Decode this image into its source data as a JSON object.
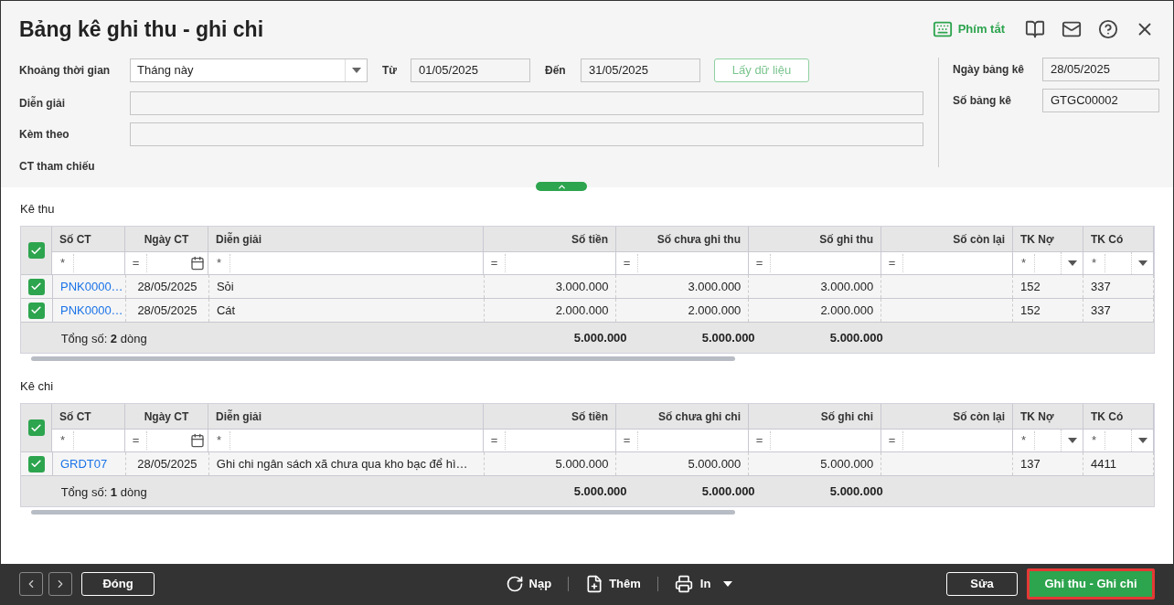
{
  "window": {
    "title": "Bảng kê ghi thu - ghi chi"
  },
  "header_actions": {
    "shortcuts": "Phím tắt"
  },
  "form": {
    "period_label": "Khoảng thời gian",
    "period_value": "Tháng này",
    "from_label": "Từ",
    "from_value": "01/05/2025",
    "to_label": "Đến",
    "to_value": "31/05/2025",
    "fetch_button": "Lấy dữ liệu",
    "description_label": "Diễn giải",
    "attached_label": "Kèm theo",
    "reference_label": "CT tham chiếu",
    "date_label": "Ngày bảng kê",
    "date_value": "28/05/2025",
    "number_label": "Số bảng kê",
    "number_value": "GTGC00002"
  },
  "sections": [
    {
      "title": "Kê thu",
      "all_checked": true,
      "columns": [
        {
          "label": "Số CT",
          "filter": "*",
          "kind": "text"
        },
        {
          "label": "Ngày CT",
          "filter": "=",
          "kind": "date"
        },
        {
          "label": "Diễn giải",
          "filter": "*",
          "kind": "text"
        },
        {
          "label": "Số tiền",
          "filter": "=",
          "kind": "number",
          "total": "5.000.000"
        },
        {
          "label": "Số chưa ghi thu",
          "filter": "=",
          "kind": "number",
          "total": "5.000.000"
        },
        {
          "label": "Số ghi thu",
          "filter": "=",
          "kind": "number",
          "total": "5.000.000"
        },
        {
          "label": "Số còn lại",
          "filter": "=",
          "kind": "number"
        },
        {
          "label": "TK Nợ",
          "filter": "*",
          "kind": "account"
        },
        {
          "label": "TK Có",
          "filter": "*",
          "kind": "account"
        }
      ],
      "rows": [
        {
          "checked": true,
          "voucher": "PNK0000…",
          "date": "28/05/2025",
          "description": "Sỏi",
          "amount": "3.000.000",
          "pending": "3.000.000",
          "recorded": "3.000.000",
          "debit": "152",
          "credit": "337"
        },
        {
          "checked": true,
          "voucher": "PNK0000…",
          "date": "28/05/2025",
          "description": "Cát",
          "amount": "2.000.000",
          "pending": "2.000.000",
          "recorded": "2.000.000",
          "debit": "152",
          "credit": "337"
        }
      ],
      "summary": "Tổng số: **2** dòng"
    },
    {
      "title": "Kê chi",
      "all_checked": true,
      "columns": [
        {
          "label": "Số CT",
          "filter": "*",
          "kind": "text"
        },
        {
          "label": "Ngày CT",
          "filter": "=",
          "kind": "date"
        },
        {
          "label": "Diễn giải",
          "filter": "*",
          "kind": "text"
        },
        {
          "label": "Số tiền",
          "filter": "=",
          "kind": "number",
          "total": "5.000.000"
        },
        {
          "label": "Số chưa ghi chi",
          "filter": "=",
          "kind": "number",
          "total": "5.000.000"
        },
        {
          "label": "Số ghi chi",
          "filter": "=",
          "kind": "number",
          "total": "5.000.000"
        },
        {
          "label": "Số còn lại",
          "filter": "=",
          "kind": "number"
        },
        {
          "label": "TK Nợ",
          "filter": "*",
          "kind": "account"
        },
        {
          "label": "TK Có",
          "filter": "*",
          "kind": "account"
        }
      ],
      "rows": [
        {
          "checked": true,
          "voucher": "GRDT07",
          "date": "28/05/2025",
          "description": "Ghi chi ngân sách xã chưa qua kho bạc để hì…",
          "amount": "5.000.000",
          "pending": "5.000.000",
          "recorded": "5.000.000",
          "debit": "137",
          "credit": "4411"
        }
      ],
      "summary": "Tổng số: **1** dòng"
    }
  ],
  "footer": {
    "close_button": "Đóng",
    "reload_button": "Nạp",
    "add_button": "Thêm",
    "print_button": "In",
    "edit_button": "Sửa",
    "save_button": {
      "label": "Ghi thu - Ghi chi",
      "highlighted": true
    }
  }
}
